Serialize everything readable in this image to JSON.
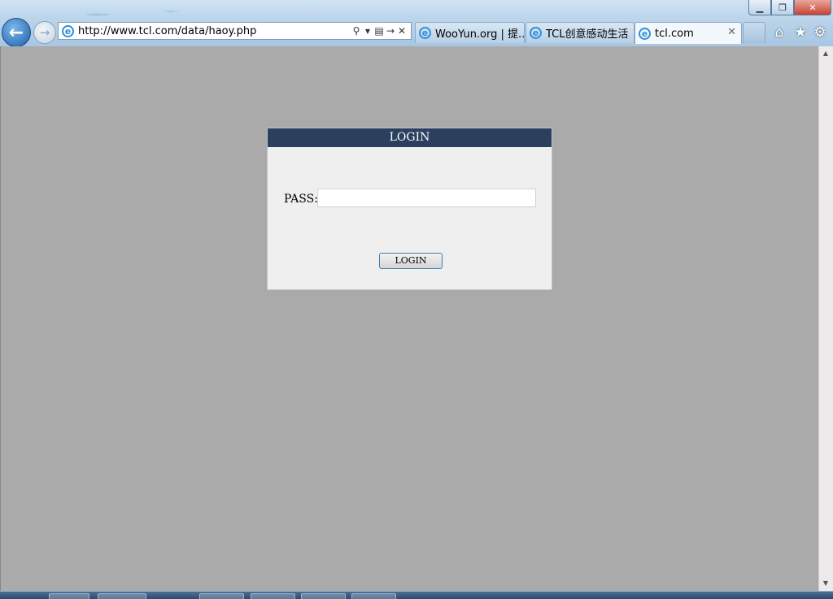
{
  "browser": {
    "url": "http://www.tcl.com/data/haoy.php",
    "tabs": [
      {
        "label": "WooYun.org | 提..."
      },
      {
        "label": "TCL创意感动生活"
      },
      {
        "label": "tcl.com"
      }
    ],
    "window_buttons": {
      "minimize": "▁",
      "maximize": "❐",
      "close": "✕"
    },
    "icons": {
      "back": "back-arrow-icon",
      "forward": "forward-arrow-icon",
      "search": "search-icon",
      "compat": "compatibility-view-icon",
      "refresh": "refresh-icon",
      "stop": "stop-icon",
      "home": "home-icon",
      "favorites": "star-icon",
      "tools": "gear-icon"
    }
  },
  "login_panel": {
    "title": "LOGIN",
    "pass_label": "PASS:",
    "pass_value": "",
    "button_label": "LOGIN"
  },
  "colors": {
    "page_background": "#aaaaaa",
    "panel_header": "#2b3f5f",
    "panel_background": "#efefef"
  }
}
